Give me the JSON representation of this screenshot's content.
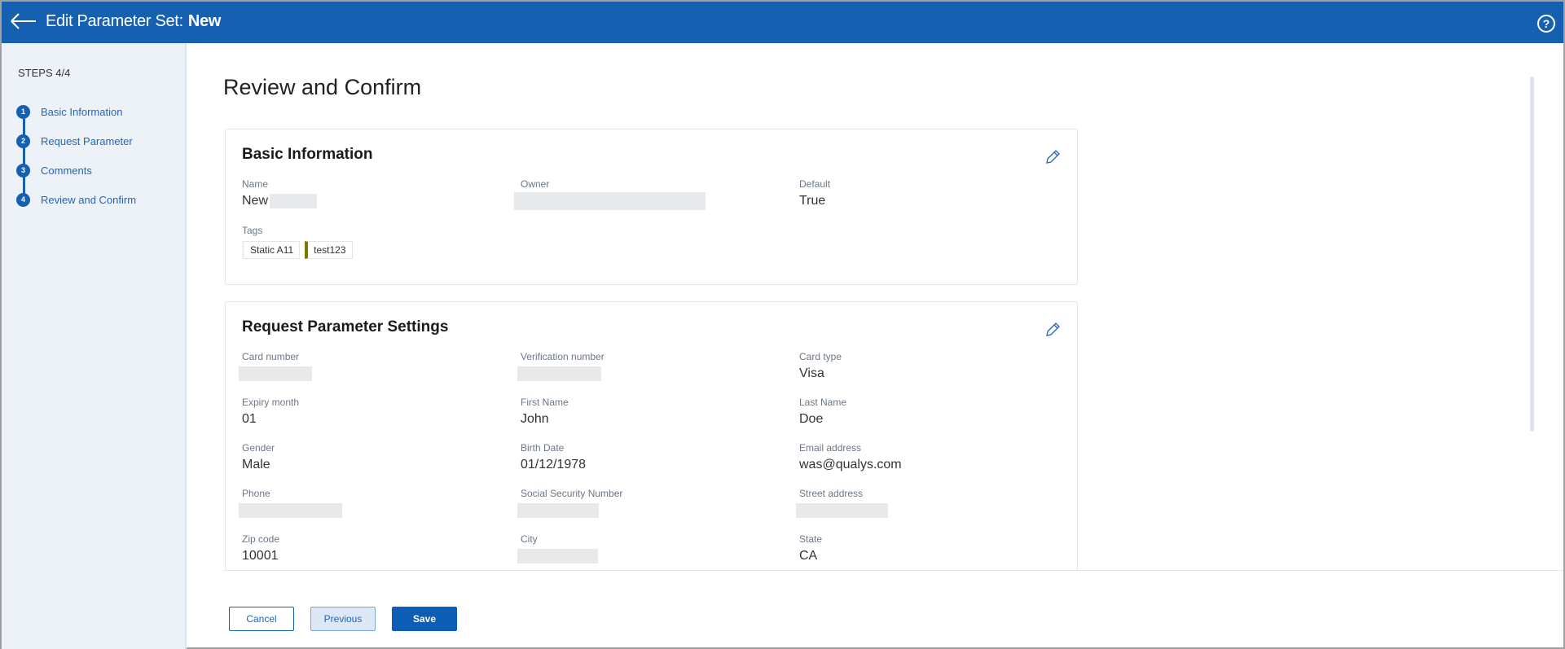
{
  "header": {
    "title": "Edit Parameter Set:",
    "name": "New",
    "help_icon": "question-circle-icon",
    "back_icon": "arrow-left-icon"
  },
  "sidebar": {
    "steps_label": "STEPS 4/4",
    "steps": [
      {
        "num": "1",
        "label": "Basic Information"
      },
      {
        "num": "2",
        "label": "Request Parameter"
      },
      {
        "num": "3",
        "label": "Comments"
      },
      {
        "num": "4",
        "label": "Review and Confirm"
      }
    ]
  },
  "page_title": "Review and Confirm",
  "basic": {
    "title": "Basic Information",
    "name_label": "Name",
    "name_value": "New",
    "owner_label": "Owner",
    "default_label": "Default",
    "default_value": "True",
    "tags_label": "Tags",
    "tags": [
      "Static A11",
      "test123"
    ]
  },
  "request": {
    "title": "Request Parameter Settings",
    "fields": [
      {
        "label": "Card number",
        "value": ""
      },
      {
        "label": "Verification number",
        "value": ""
      },
      {
        "label": "Card type",
        "value": "Visa"
      },
      {
        "label": "Expiry month",
        "value": "01"
      },
      {
        "label": "First Name",
        "value": "John"
      },
      {
        "label": "Last Name",
        "value": "Doe"
      },
      {
        "label": "Gender",
        "value": "Male"
      },
      {
        "label": "Birth Date",
        "value": "01/12/1978"
      },
      {
        "label": "Email address",
        "value": "was@qualys.com"
      },
      {
        "label": "Phone",
        "value": ""
      },
      {
        "label": "Social Security Number",
        "value": ""
      },
      {
        "label": "Street address",
        "value": ""
      },
      {
        "label": "Zip code",
        "value": "10001"
      },
      {
        "label": "City",
        "value": ""
      },
      {
        "label": "State",
        "value": "CA"
      }
    ]
  },
  "footer": {
    "cancel": "Cancel",
    "previous": "Previous",
    "save": "Save"
  },
  "colors": {
    "brand": "#1560b0",
    "tag_accent": "#7a7a00"
  }
}
